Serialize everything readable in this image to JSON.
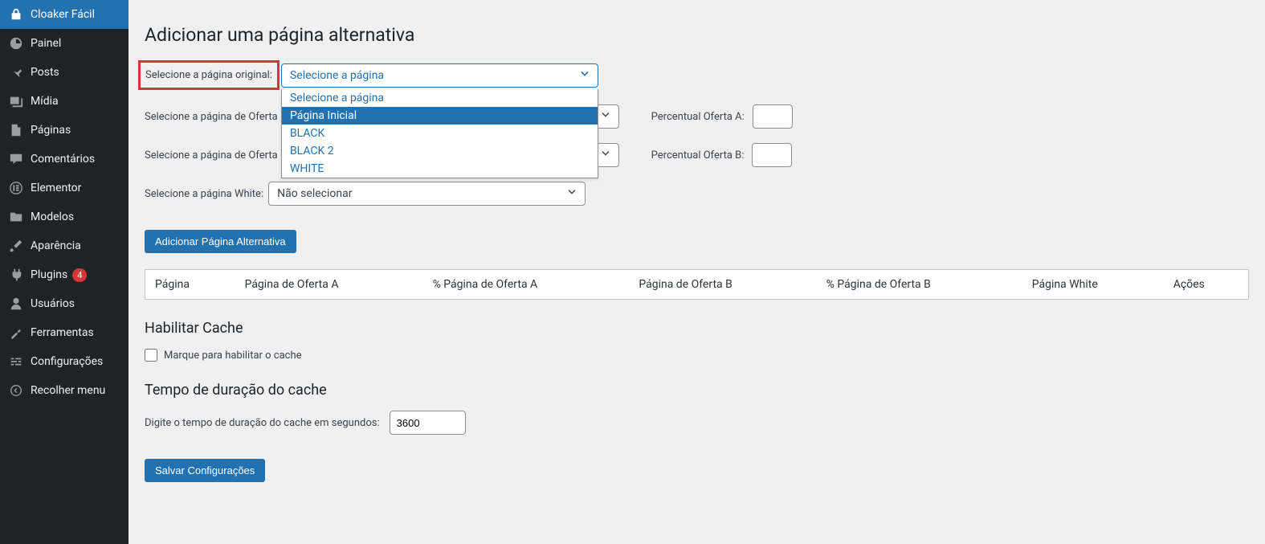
{
  "sidebar": {
    "items": [
      {
        "label": "Cloaker Fácil",
        "icon": "lock",
        "active": true
      },
      {
        "label": "Painel",
        "icon": "dashboard"
      },
      {
        "label": "Posts",
        "icon": "pin"
      },
      {
        "label": "Mídia",
        "icon": "media"
      },
      {
        "label": "Páginas",
        "icon": "pages"
      },
      {
        "label": "Comentários",
        "icon": "comments"
      },
      {
        "label": "Elementor",
        "icon": "elementor"
      },
      {
        "label": "Modelos",
        "icon": "folder"
      },
      {
        "label": "Aparência",
        "icon": "brush"
      },
      {
        "label": "Plugins",
        "icon": "plug",
        "badge": "4"
      },
      {
        "label": "Usuários",
        "icon": "user"
      },
      {
        "label": "Ferramentas",
        "icon": "wrench"
      },
      {
        "label": "Configurações",
        "icon": "sliders"
      },
      {
        "label": "Recolher menu",
        "icon": "collapse"
      }
    ]
  },
  "headings": {
    "add_alt": "Adicionar uma página alternativa",
    "cache": "Habilitar Cache",
    "cache_time": "Tempo de duração do cache"
  },
  "labels": {
    "original": "Selecione a página original:",
    "oferta_a": "Selecione a página de Oferta",
    "oferta_b": "Selecione a página de Oferta",
    "white": "Selecione a página White:",
    "percent_a": "Percentual Oferta A:",
    "percent_b": "Percentual Oferta B:",
    "cache_checkbox": "Marque para habilitar o cache",
    "cache_seconds": "Digite o tempo de duração do cache em segundos:"
  },
  "select": {
    "placeholder": "Selecione a página",
    "nao_selecionar": "Não selecionar",
    "options": [
      "Selecione a página",
      "Página Inicial",
      "BLACK",
      "BLACK 2",
      "WHITE"
    ],
    "highlighted_index": 1
  },
  "buttons": {
    "add": "Adicionar Página Alternativa",
    "save": "Salvar Configurações"
  },
  "table": {
    "headers": [
      "Página",
      "Página de Oferta A",
      "% Página de Oferta A",
      "Página de Oferta B",
      "% Página de Oferta B",
      "Página White",
      "Ações"
    ]
  },
  "inputs": {
    "percent_a": "",
    "percent_b": "",
    "cache_seconds": "3600"
  }
}
